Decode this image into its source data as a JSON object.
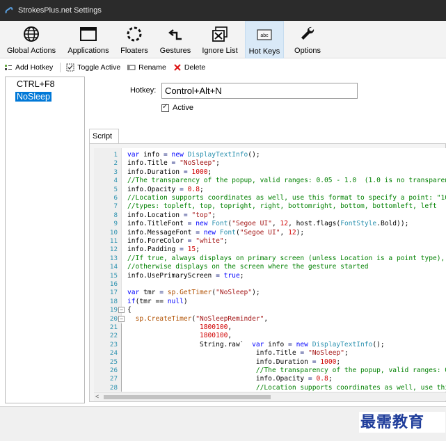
{
  "window": {
    "title": "StrokesPlus.net Settings"
  },
  "toolbar": {
    "items": [
      {
        "label": "Global Actions",
        "icon": "globe-icon"
      },
      {
        "label": "Applications",
        "icon": "window-icon"
      },
      {
        "label": "Floaters",
        "icon": "floater-ring-icon"
      },
      {
        "label": "Gestures",
        "icon": "gesture-arrow-icon"
      },
      {
        "label": "Ignore List",
        "icon": "ignore-list-icon"
      },
      {
        "label": "Hot Keys",
        "icon": "keyboard-abc-icon"
      },
      {
        "label": "Options",
        "icon": "wrench-icon"
      }
    ],
    "active": "Hot Keys"
  },
  "actions": {
    "add_hotkey": "Add Hotkey",
    "toggle_active": "Toggle Active",
    "rename": "Rename",
    "delete": "Delete"
  },
  "hotkey_list": {
    "items": [
      {
        "label": "CTRL+F8",
        "selected": false
      },
      {
        "label": "NoSleep",
        "selected": true
      }
    ]
  },
  "hotkey_form": {
    "hotkey_label": "Hotkey:",
    "hotkey_value": "Control+Alt+N",
    "active_label": "Active",
    "active_checked": true
  },
  "script": {
    "tab_label": "Script",
    "line_numbers": [
      "1",
      "2",
      "3",
      "4",
      "5",
      "6",
      "7",
      "8",
      "9",
      "10",
      "11",
      "12",
      "13",
      "14",
      "15",
      "16",
      "17",
      "18",
      "19",
      "20",
      "21",
      "22",
      "23",
      "24",
      "25",
      "26",
      "27",
      "28"
    ]
  },
  "watermark": {
    "text": "最需教育"
  },
  "colors": {
    "titlebar": "#2b2b2b",
    "selection": "#0078d7",
    "active_tool": "#d9e9f7",
    "keyword": "#0000ff",
    "type": "#2b91af",
    "string": "#a31515",
    "comment": "#008000",
    "number": "#d00000"
  }
}
